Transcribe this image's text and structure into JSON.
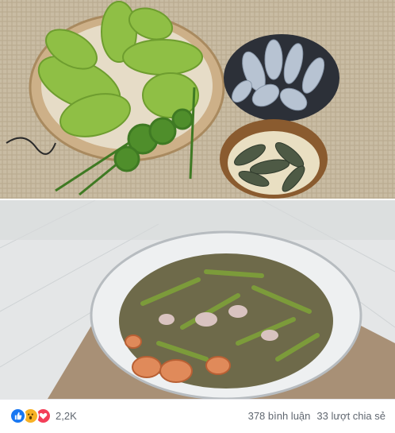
{
  "photos": [
    {
      "alt_icon": "cactus-leaves-squid-shrimp-photo"
    },
    {
      "alt_icon": "soup-bowl-photo"
    }
  ],
  "reactions": {
    "icons": [
      "like-icon",
      "wow-icon",
      "love-icon"
    ],
    "colors": {
      "like": "#1877f2",
      "wow": "#f7b125",
      "love": "#f33e58"
    },
    "count": "2,2K"
  },
  "stats": {
    "comments": "378 bình luận",
    "shares": "33 lượt chia sẻ"
  }
}
